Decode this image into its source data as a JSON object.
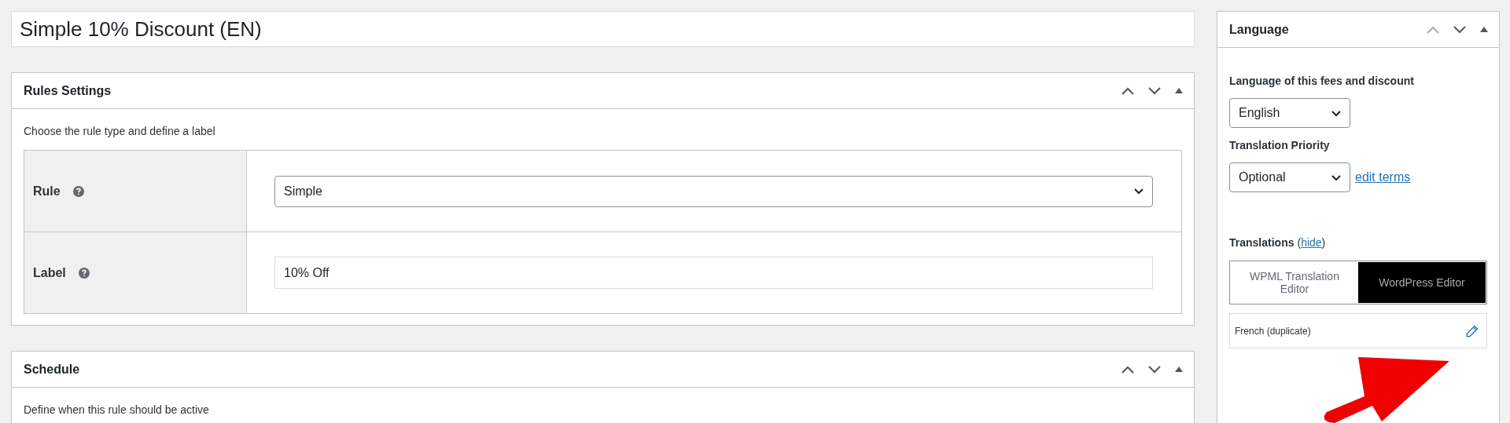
{
  "title_field": {
    "value": "Simple 10% Discount (EN)"
  },
  "panels": [
    {
      "title": "Rules Settings",
      "description": "Choose the rule type and define a label",
      "rows": [
        {
          "label": "Rule",
          "kind": "select",
          "value": "Simple"
        },
        {
          "label": "Label",
          "kind": "text",
          "value": "10% Off"
        }
      ]
    },
    {
      "title": "Schedule",
      "description": "Define when this rule should be active"
    }
  ],
  "sidebar": {
    "title": "Language",
    "language_label": "Language of this fees and discount",
    "language_select": "English",
    "priority_label": "Translation Priority",
    "priority_select": "Optional",
    "edit_terms_link": "edit terms",
    "translations_label": "Translations",
    "hide_link": "hide",
    "paren_open": "(",
    "paren_close": ")",
    "editor_toggle": [
      {
        "label": "WPML Translation Editor",
        "selected": false
      },
      {
        "label": "WordPress Editor",
        "selected": true
      }
    ],
    "translation_rows": [
      {
        "label": "French (duplicate)"
      }
    ]
  }
}
